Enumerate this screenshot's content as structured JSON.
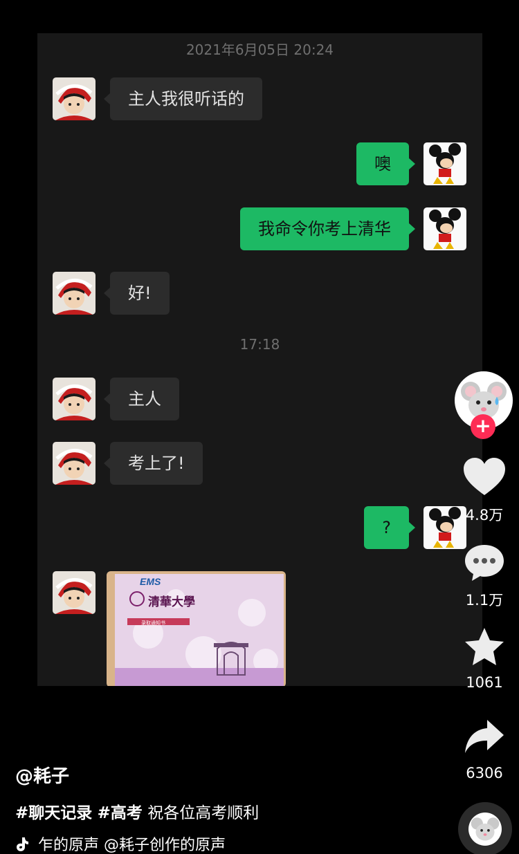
{
  "chat": {
    "timestamp_1": "2021年6月05日 20:24",
    "timestamp_2": "17:18",
    "messages": [
      {
        "side": "in",
        "text": "主人我很听话的"
      },
      {
        "side": "out",
        "text": "噢"
      },
      {
        "side": "out",
        "text": "我命令你考上清华"
      },
      {
        "side": "in",
        "text": "好!"
      },
      {
        "side": "in",
        "text": "主人"
      },
      {
        "side": "in",
        "text": "考上了!"
      },
      {
        "side": "out",
        "text": "?"
      }
    ],
    "letter": {
      "ems_label": "EMS",
      "school_name": "清華大學",
      "notice_label": "录取通知书"
    }
  },
  "rail": {
    "likes": "4.8万",
    "comments": "1.1万",
    "favorites": "1061",
    "shares": "6306",
    "follow_symbol": "+"
  },
  "post": {
    "author": "@耗子",
    "hashtag_1": "#聊天记录",
    "hashtag_2": "#高考",
    "caption_text": "祝各位高考顺利",
    "music_text": "乍的原声    @耗子创作的原声"
  },
  "colors": {
    "outgoing_bubble": "#1db964",
    "incoming_bubble": "#2c2c2c",
    "chat_background": "#181818",
    "follow_button": "#fe2c55"
  }
}
